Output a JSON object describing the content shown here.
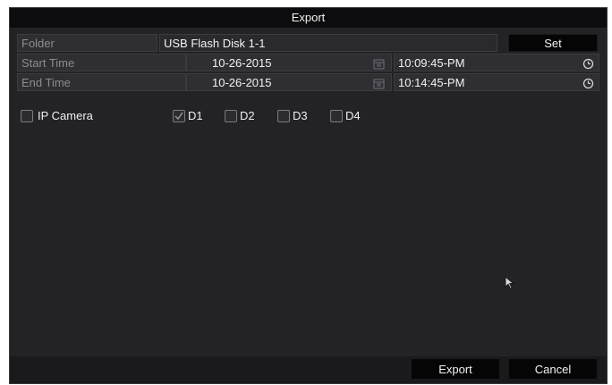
{
  "dialog": {
    "title": "Export"
  },
  "folder": {
    "label": "Folder",
    "value": "USB Flash Disk 1-1",
    "set_label": "Set"
  },
  "start_time": {
    "label": "Start Time",
    "date": "10-26-2015",
    "time": "10:09:45-PM"
  },
  "end_time": {
    "label": "End Time",
    "date": "10-26-2015",
    "time": "10:14:45-PM"
  },
  "cameras": {
    "ip_camera_label": "IP Camera",
    "ip_camera_checked": false,
    "channels": [
      {
        "label": "D1",
        "checked": true
      },
      {
        "label": "D2",
        "checked": false
      },
      {
        "label": "D3",
        "checked": false
      },
      {
        "label": "D4",
        "checked": false
      }
    ]
  },
  "footer": {
    "export_label": "Export",
    "cancel_label": "Cancel"
  },
  "icons": {
    "date_picker": "calendar-icon",
    "time_picker": "clock-icon",
    "pointer": "mouse-cursor-icon"
  },
  "colors": {
    "dialog_bg": "#232326",
    "titlebar_bg": "#0c0c0e",
    "button_bg": "#050506",
    "label_text": "#8b8b90",
    "value_text": "#f2f2f2"
  }
}
